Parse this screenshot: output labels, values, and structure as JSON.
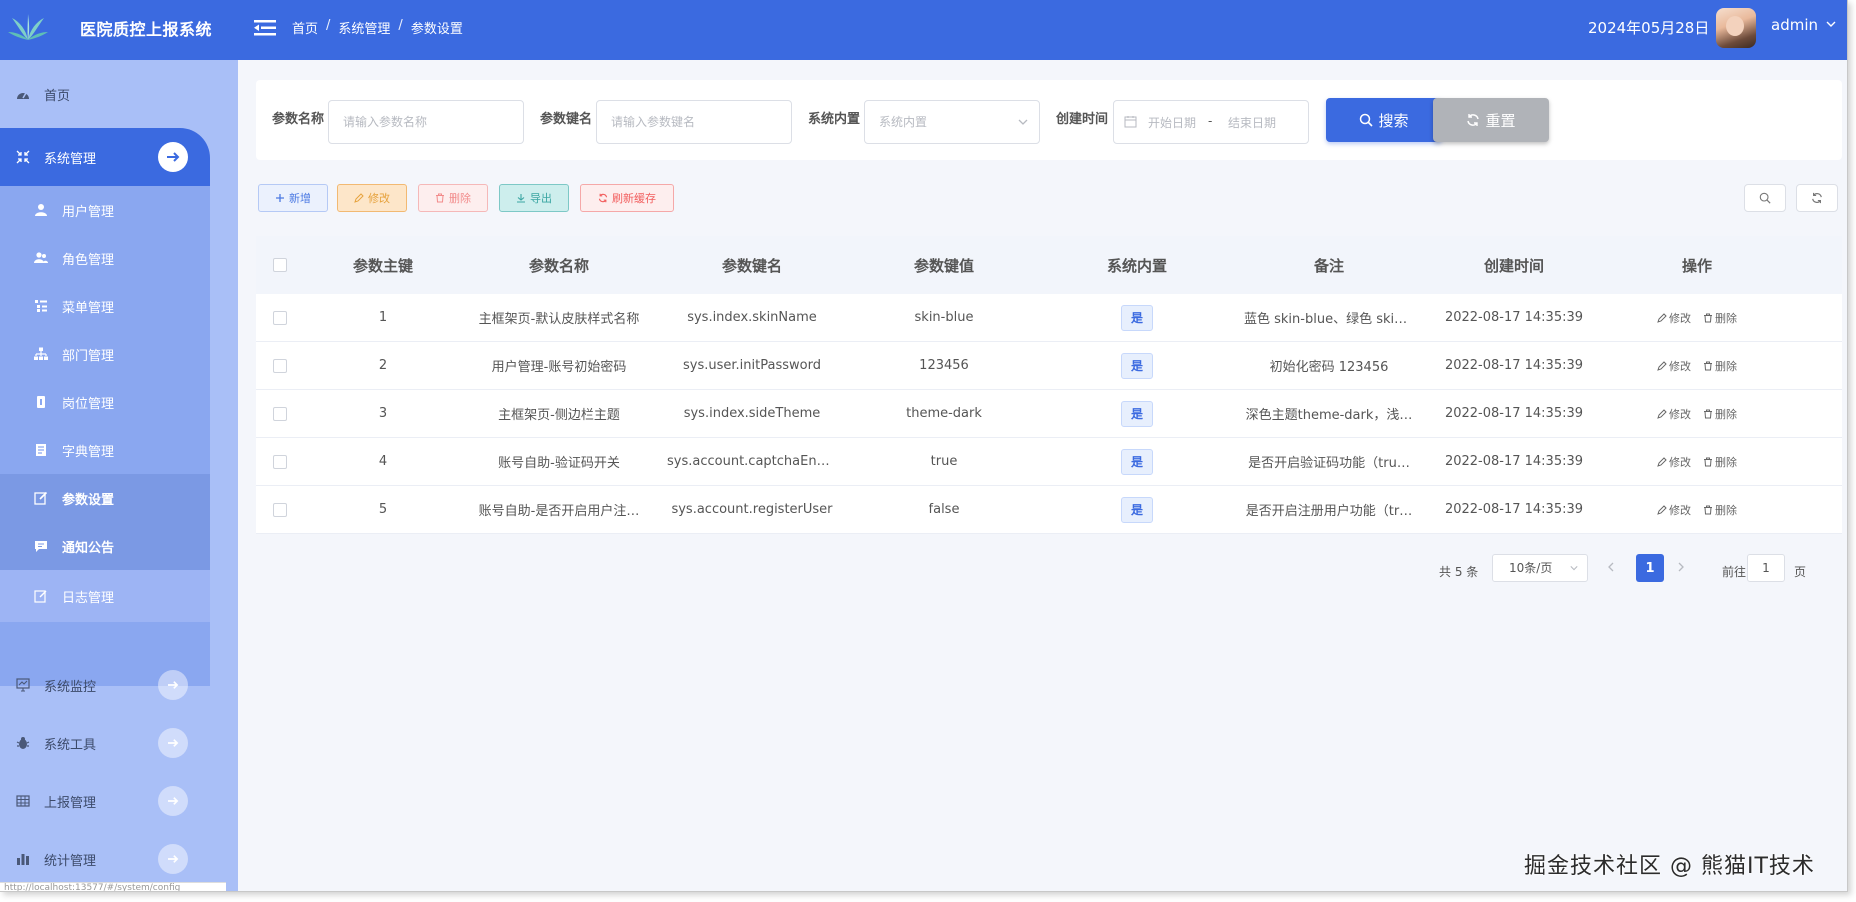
{
  "header": {
    "app_title": "医院质控上报系统",
    "breadcrumb": [
      "首页",
      "系统管理",
      "参数设置"
    ],
    "breadcrumb_sep": "/",
    "date": "2024年05月28日",
    "username": "admin"
  },
  "sidebar": {
    "home": "首页",
    "active_group": "系统管理",
    "sub_items": [
      "用户管理",
      "角色管理",
      "菜单管理",
      "部门管理",
      "岗位管理",
      "字典管理",
      "参数设置",
      "通知公告",
      "日志管理"
    ],
    "current_sub": "参数设置",
    "groups": [
      "系统监控",
      "系统工具",
      "上报管理",
      "统计管理"
    ],
    "status_url": "http://localhost:13577/#/system/config"
  },
  "search": {
    "param_name_label": "参数名称",
    "param_name_placeholder": "请输入参数名称",
    "param_key_label": "参数键名",
    "param_key_placeholder": "请输入参数键名",
    "builtin_label": "系统内置",
    "builtin_placeholder": "系统内置",
    "created_label": "创建时间",
    "start_placeholder": "开始日期",
    "range_sep": "-",
    "end_placeholder": "结束日期",
    "search_btn": "搜索",
    "reset_btn": "重置"
  },
  "toolbar": {
    "add": "新增",
    "edit": "修改",
    "delete": "删除",
    "export": "导出",
    "refresh_cache": "刷新缓存"
  },
  "table": {
    "columns": [
      "参数主键",
      "参数名称",
      "参数键名",
      "参数键值",
      "系统内置",
      "备注",
      "创建时间",
      "操作"
    ],
    "rows": [
      {
        "id": "1",
        "name": "主框架页-默认皮肤样式名称",
        "key": "sys.index.skinName",
        "value": "skin-blue",
        "builtin": "是",
        "remark": "蓝色 skin-blue、绿色 skin…",
        "created": "2022-08-17 14:35:39"
      },
      {
        "id": "2",
        "name": "用户管理-账号初始密码",
        "key": "sys.user.initPassword",
        "value": "123456",
        "builtin": "是",
        "remark": "初始化密码 123456",
        "created": "2022-08-17 14:35:39"
      },
      {
        "id": "3",
        "name": "主框架页-侧边栏主题",
        "key": "sys.index.sideTheme",
        "value": "theme-dark",
        "builtin": "是",
        "remark": "深色主题theme-dark，浅…",
        "created": "2022-08-17 14:35:39"
      },
      {
        "id": "4",
        "name": "账号自助-验证码开关",
        "key": "sys.account.captchaEnabl…",
        "value": "true",
        "builtin": "是",
        "remark": "是否开启验证码功能（tru…",
        "created": "2022-08-17 14:35:39"
      },
      {
        "id": "5",
        "name": "账号自助-是否开启用户注…",
        "key": "sys.account.registerUser",
        "value": "false",
        "builtin": "是",
        "remark": "是否开启注册用户功能（tr…",
        "created": "2022-08-17 14:35:39"
      }
    ],
    "op_edit": "修改",
    "op_delete": "删除"
  },
  "pagination": {
    "total": "共 5 条",
    "page_size": "10条/页",
    "current_page": "1",
    "goto_label": "前往",
    "goto_value": "1",
    "page_suffix": "页"
  },
  "watermark": "掘金技术社区 @ 熊猫IT技术",
  "colors": {
    "primary": "#3b6ae0",
    "sidebar": "#a9bff7",
    "reset_button": "#b0b3b8"
  }
}
